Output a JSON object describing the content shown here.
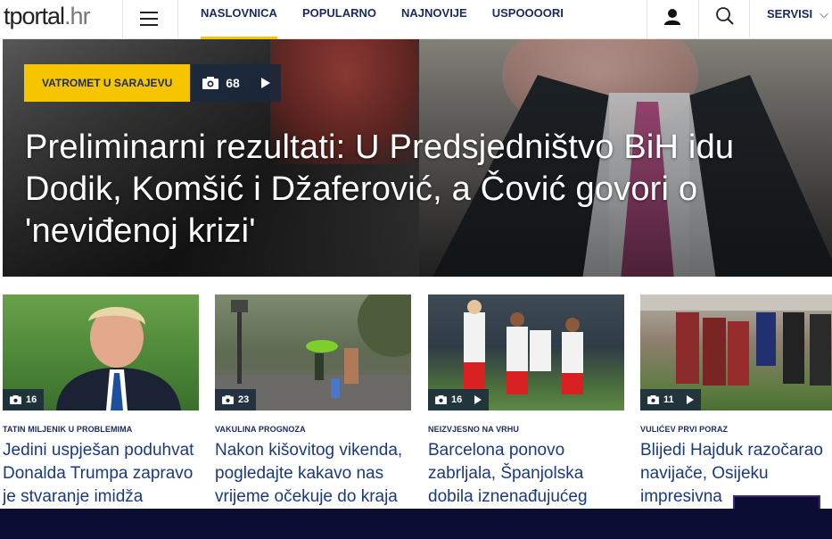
{
  "header": {
    "logo_main": "tportal",
    "logo_suffix": ".hr",
    "nav": [
      {
        "label": "NASLOVNICA",
        "active": true
      },
      {
        "label": "POPULARNO",
        "active": false
      },
      {
        "label": "NAJNOVIJE",
        "active": false
      },
      {
        "label": "USPOOOORI",
        "active": false
      }
    ],
    "servisi_label": "SERVISI",
    "icons": [
      "menu-icon",
      "user-icon",
      "search-icon",
      "chevron-down-icon"
    ],
    "accent_color": "#f7c400",
    "nav_color": "#1a2a5e"
  },
  "hero": {
    "tag": "VATROMET U SARAJEVU",
    "gallery_count": "68",
    "title": "Preliminarni rezultati: U Predsjedništvo BiH idu Dodik, Komšić i Džaferović, a Čović govori o 'neviđenoj krizi'"
  },
  "cards": [
    {
      "kicker": "TATIN MILJENIK U PROBLEMIMA",
      "headline": "Jedini uspješan poduhvat Donalda Trumpa zapravo je stvaranje imidža",
      "count": "16",
      "video": false
    },
    {
      "kicker": "VAKULINA PROGNOZA",
      "headline": "Nakon kišovitog vikenda, pogledajte kakavo nas vrijeme očekuje do kraja",
      "count": "23",
      "video": false
    },
    {
      "kicker": "NEIZVJESNO NA VRHU",
      "headline": "Barcelona ponovo zabrljala, Španjolska dobila iznenađujućeg",
      "count": "16",
      "video": true
    },
    {
      "kicker": "VULIĆEV PRVI PORAZ",
      "headline": "Blijedi Hajduk razočarao navijače, Osijeku impresivna",
      "count": "11",
      "video": true
    }
  ]
}
